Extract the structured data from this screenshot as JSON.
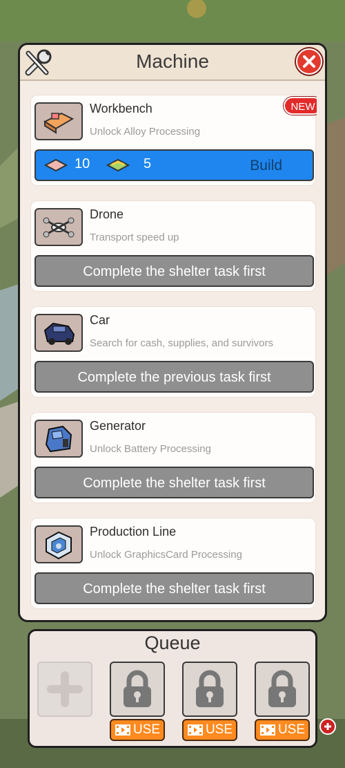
{
  "panel": {
    "title": "Machine",
    "close_icon": "close-icon",
    "tools_icon": "wrench-screwdriver-icon"
  },
  "machines": [
    {
      "name": "Workbench",
      "desc": "Unlock Alloy Processing",
      "badge": "NEW",
      "icon": "workbench-icon",
      "cost": [
        {
          "icon": "alloy-plate-icon",
          "value": "10"
        },
        {
          "icon": "gold-bar-icon",
          "value": "5"
        }
      ],
      "action": "Build"
    },
    {
      "name": "Drone",
      "desc": "Transport speed up",
      "icon": "drone-icon",
      "action": "Complete the shelter task first"
    },
    {
      "name": "Car",
      "desc": "Search for cash, supplies, and survivors",
      "icon": "car-icon",
      "action": "Complete the previous task first"
    },
    {
      "name": "Generator",
      "desc": "Unlock Battery Processing",
      "icon": "generator-icon",
      "action": "Complete the shelter task first"
    },
    {
      "name": "Production Line",
      "desc": "Unlock GraphicsCard Processing",
      "icon": "production-line-icon",
      "action": "Complete the shelter task first"
    }
  ],
  "queue": {
    "title": "Queue",
    "add_icon": "plus-icon",
    "locked_slots": [
      {
        "icon": "lock-icon",
        "button": "USE",
        "button_icon": "video-icon"
      },
      {
        "icon": "lock-icon",
        "button": "USE",
        "button_icon": "video-icon"
      },
      {
        "icon": "lock-icon",
        "button": "USE",
        "button_icon": "video-icon"
      }
    ]
  },
  "colors": {
    "build_blue": "#1e86ee",
    "locked_gray": "#8f8f8f",
    "badge_red": "#e32a2a",
    "use_orange": "#ff8a1f"
  }
}
